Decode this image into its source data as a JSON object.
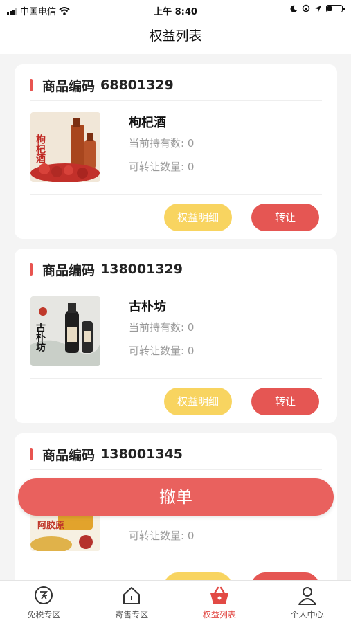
{
  "status_bar": {
    "carrier": "中国电信",
    "time": "上午 8:40"
  },
  "header": {
    "title": "权益列表"
  },
  "labels": {
    "code_prefix": "商品编码",
    "holding_label": "当前持有数:",
    "transferable_label": "可转让数量:",
    "detail_button": "权益明细",
    "transfer_button": "转让"
  },
  "products": [
    {
      "code": "68801329",
      "name": "枸杞酒",
      "holding": "0",
      "transferable": "0",
      "image_text": "枸杞酒"
    },
    {
      "code": "138001329",
      "name": "古朴坊",
      "holding": "0",
      "transferable": "0",
      "image_text": "古朴坊"
    },
    {
      "code": "138001345",
      "name": "",
      "holding": "",
      "transferable": "0",
      "image_text": "阿胶原"
    }
  ],
  "overlay": {
    "cancel_label": "撤单"
  },
  "tabs": [
    {
      "label": "免税专区",
      "icon": "duty-free-icon",
      "active": false
    },
    {
      "label": "寄售专区",
      "icon": "home-icon",
      "active": false
    },
    {
      "label": "权益列表",
      "icon": "basket-icon",
      "active": true
    },
    {
      "label": "个人中心",
      "icon": "person-icon",
      "active": false
    }
  ],
  "colors": {
    "accent": "#e55653",
    "detail_button": "#f8d460",
    "active_tab": "#e24a45"
  }
}
